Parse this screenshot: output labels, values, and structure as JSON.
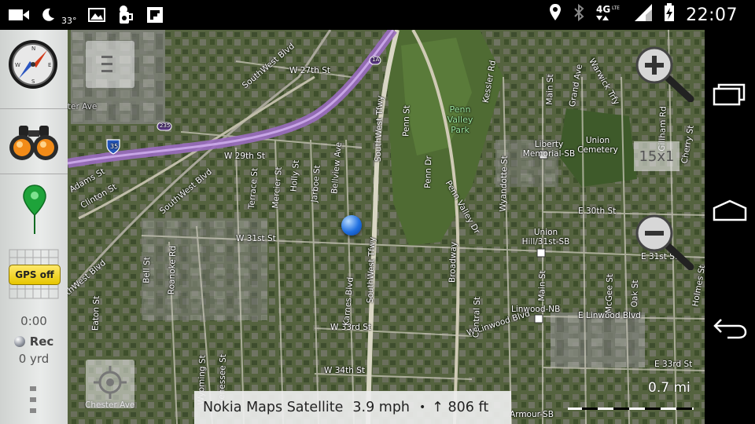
{
  "status_bar": {
    "left_icons": [
      "video-camera-icon",
      "moon-icon",
      "image-icon",
      "beer-icon",
      "flipboard-icon"
    ],
    "temperature": "33°",
    "right_icons": [
      "location-pin-icon",
      "bluetooth-icon",
      "4g-lte-icon",
      "signal-icon",
      "battery-charging-icon"
    ],
    "network": "4G LTE",
    "time": "22:07"
  },
  "side_panel": {
    "compass_label": "compass",
    "gps_button": "GPS off",
    "timer": "0:00",
    "rec_label": "Rec",
    "distance": "0 yrd"
  },
  "map": {
    "zoom_scale": "15x1",
    "info": {
      "source": "Nokia Maps Satellite",
      "speed": "3.9 mph",
      "separator": "•",
      "altitude": "↑ 806 ft"
    },
    "scale_label": "0.7 mi",
    "labels": [
      {
        "id": "w27th",
        "text": "W 27th St"
      },
      {
        "id": "sw_blvd1",
        "text": "SouthWest Blvd"
      },
      {
        "id": "sw_blvd2",
        "text": "SouthWest Blvd"
      },
      {
        "id": "sw_blvd3",
        "text": "SouthWest Blvd"
      },
      {
        "id": "w29th",
        "text": "W 29th St"
      },
      {
        "id": "w31st",
        "text": "W 31st St"
      },
      {
        "id": "w33rd",
        "text": "W 33rd St"
      },
      {
        "id": "w34th",
        "text": "W 34th St"
      },
      {
        "id": "sw_tfwy1",
        "text": "SouthWest Tfwy"
      },
      {
        "id": "sw_tfwy2",
        "text": "SouthWest Tfwy"
      },
      {
        "id": "penn_valley",
        "text": "Penn Valley Park"
      },
      {
        "id": "liberty",
        "text": "Liberty Memorial-SB"
      },
      {
        "id": "union_cem",
        "text": "Union Cemetery"
      },
      {
        "id": "union_hill",
        "text": "Union Hill/31st-SB"
      },
      {
        "id": "linwood_nb",
        "text": "Linwood-NB"
      },
      {
        "id": "e_linwood",
        "text": "E Linwood Blvd"
      },
      {
        "id": "w_linwood",
        "text": "W Linwood Blvd"
      },
      {
        "id": "broadway",
        "text": "Broadway"
      },
      {
        "id": "main1",
        "text": "Main St"
      },
      {
        "id": "main2",
        "text": "Main St"
      },
      {
        "id": "e30th",
        "text": "E 30th St"
      },
      {
        "id": "e31st",
        "text": "E 31st St"
      },
      {
        "id": "e33rd",
        "text": "E 33rd St"
      },
      {
        "id": "armour",
        "text": "Armour-SB"
      },
      {
        "id": "adams",
        "text": "Adams St"
      },
      {
        "id": "clinton",
        "text": "Clinton St"
      },
      {
        "id": "terrace",
        "text": "Terrace St"
      },
      {
        "id": "mercier",
        "text": "Mercier St"
      },
      {
        "id": "holly",
        "text": "Holly St"
      },
      {
        "id": "jarboe",
        "text": "Jarboe St"
      },
      {
        "id": "bellview",
        "text": "Bellview Ave"
      },
      {
        "id": "karnes",
        "text": "Karnes Blvd"
      },
      {
        "id": "wyandotte",
        "text": "Wyandotte St"
      },
      {
        "id": "grand",
        "text": "Grand Ave"
      },
      {
        "id": "kessler",
        "text": "Kessler Rd"
      },
      {
        "id": "penn_st",
        "text": "Penn St"
      },
      {
        "id": "penn_dr",
        "text": "Penn Dr"
      },
      {
        "id": "pv_dr",
        "text": "Penn Valley Dr"
      },
      {
        "id": "gillham",
        "text": "Gillham Rd"
      },
      {
        "id": "cherry",
        "text": "Cherry St"
      },
      {
        "id": "holmes",
        "text": "Holmes St"
      },
      {
        "id": "oak",
        "text": "Oak St"
      },
      {
        "id": "mcgee",
        "text": "McGee St"
      },
      {
        "id": "warwick",
        "text": "Warwick Trfy"
      },
      {
        "id": "central",
        "text": "Central St"
      },
      {
        "id": "eaton",
        "text": "Eaton St"
      },
      {
        "id": "bell",
        "text": "Bell St"
      },
      {
        "id": "roanoke",
        "text": "Roanoke Rd"
      },
      {
        "id": "wyoming",
        "text": "Wyoming St"
      },
      {
        "id": "genessee",
        "text": "Genessee St"
      },
      {
        "id": "chester",
        "text": "Chester Ave"
      },
      {
        "id": "chester2",
        "text": "Chester Ave"
      },
      {
        "id": "i35",
        "text": "35"
      },
      {
        "id": "hwy235",
        "text": "235"
      },
      {
        "id": "hwy1a",
        "text": "1A"
      }
    ]
  },
  "nav_bar": {
    "buttons": [
      "recent-apps",
      "home",
      "back"
    ]
  }
}
